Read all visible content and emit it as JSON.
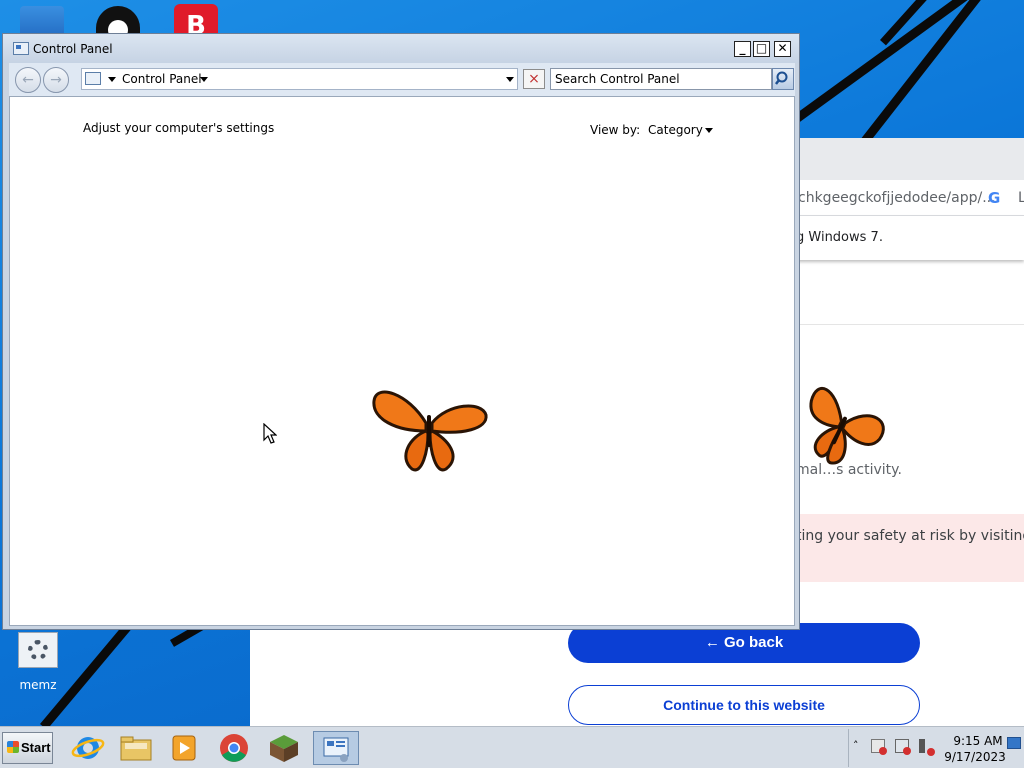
{
  "window": {
    "title": "Control Panel",
    "address": "Control Panel",
    "search_placeholder": "Search Control Panel",
    "heading": "Adjust your computer's settings",
    "view_by_label": "View by:",
    "view_by_value": "Category"
  },
  "browser": {
    "url_fragment": "chkgeegckofjjedodee/app/...",
    "profile_letter": "L",
    "info_fragment": "g Windows 7.",
    "activity_fragment": "mal…s activity.",
    "warning_fragment": "ting your safety at risk by visiting this",
    "go_back_label": "← Go back",
    "continue_label": "Continue to this website"
  },
  "desktop": {
    "icons": [
      {
        "label": "memz"
      }
    ]
  },
  "taskbar": {
    "start_label": "Start",
    "time": "9:15 AM",
    "date": "9/17/2023"
  },
  "colors": {
    "desktop_blue": "#0b76d8",
    "go_back_button": "#0b3fd4",
    "warning_bg": "#fce8e8",
    "butterfly_orange": "#f07818"
  }
}
